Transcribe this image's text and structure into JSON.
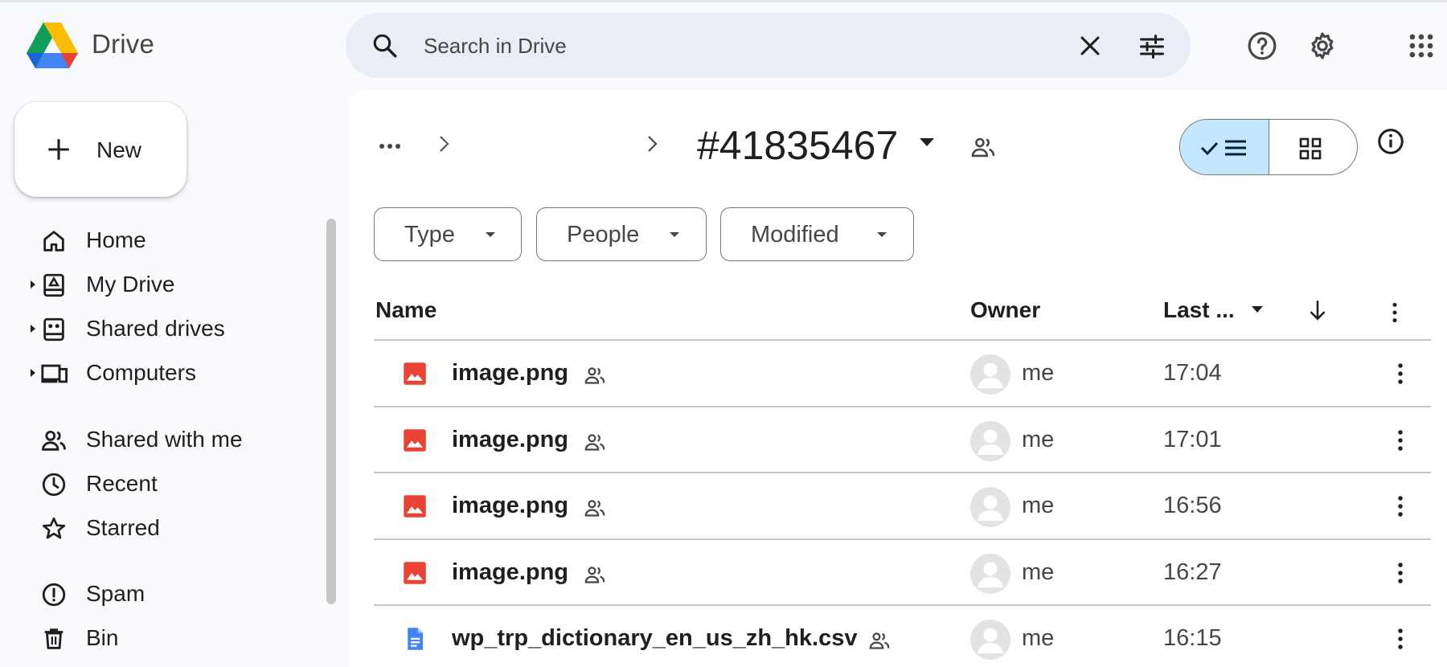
{
  "app": {
    "brand": "Drive",
    "search_placeholder": "Search in Drive"
  },
  "new_button": {
    "label": "New"
  },
  "sidebar": {
    "items": [
      {
        "label": "Home",
        "icon": "home-icon",
        "expandable": false
      },
      {
        "label": "My Drive",
        "icon": "my-drive-icon",
        "expandable": true
      },
      {
        "label": "Shared drives",
        "icon": "shared-drives-icon",
        "expandable": true
      },
      {
        "label": "Computers",
        "icon": "computers-icon",
        "expandable": true
      },
      {
        "label": "Shared with me",
        "icon": "people-icon",
        "expandable": false
      },
      {
        "label": "Recent",
        "icon": "clock-icon",
        "expandable": false
      },
      {
        "label": "Starred",
        "icon": "star-icon",
        "expandable": false
      },
      {
        "label": "Spam",
        "icon": "spam-icon",
        "expandable": false
      },
      {
        "label": "Bin",
        "icon": "bin-icon",
        "expandable": false
      }
    ]
  },
  "breadcrumb": {
    "current_folder": "#41835467"
  },
  "filters": {
    "type": "Type",
    "people": "People",
    "modified": "Modified"
  },
  "table": {
    "headers": {
      "name": "Name",
      "owner": "Owner",
      "modified": "Last ..."
    },
    "rows": [
      {
        "name": "image.png",
        "type": "image",
        "owner": "me",
        "modified": "17:04"
      },
      {
        "name": "image.png",
        "type": "image",
        "owner": "me",
        "modified": "17:01"
      },
      {
        "name": "image.png",
        "type": "image",
        "owner": "me",
        "modified": "16:56"
      },
      {
        "name": "image.png",
        "type": "image",
        "owner": "me",
        "modified": "16:27"
      },
      {
        "name": "wp_trp_dictionary_en_us_zh_hk.csv",
        "type": "doc",
        "owner": "me",
        "modified": "16:15"
      }
    ]
  },
  "colors": {
    "accent_selected": "#c2e7ff",
    "image_red": "#ea4335",
    "doc_blue": "#4285f4",
    "search_bg": "#e9eef6"
  }
}
